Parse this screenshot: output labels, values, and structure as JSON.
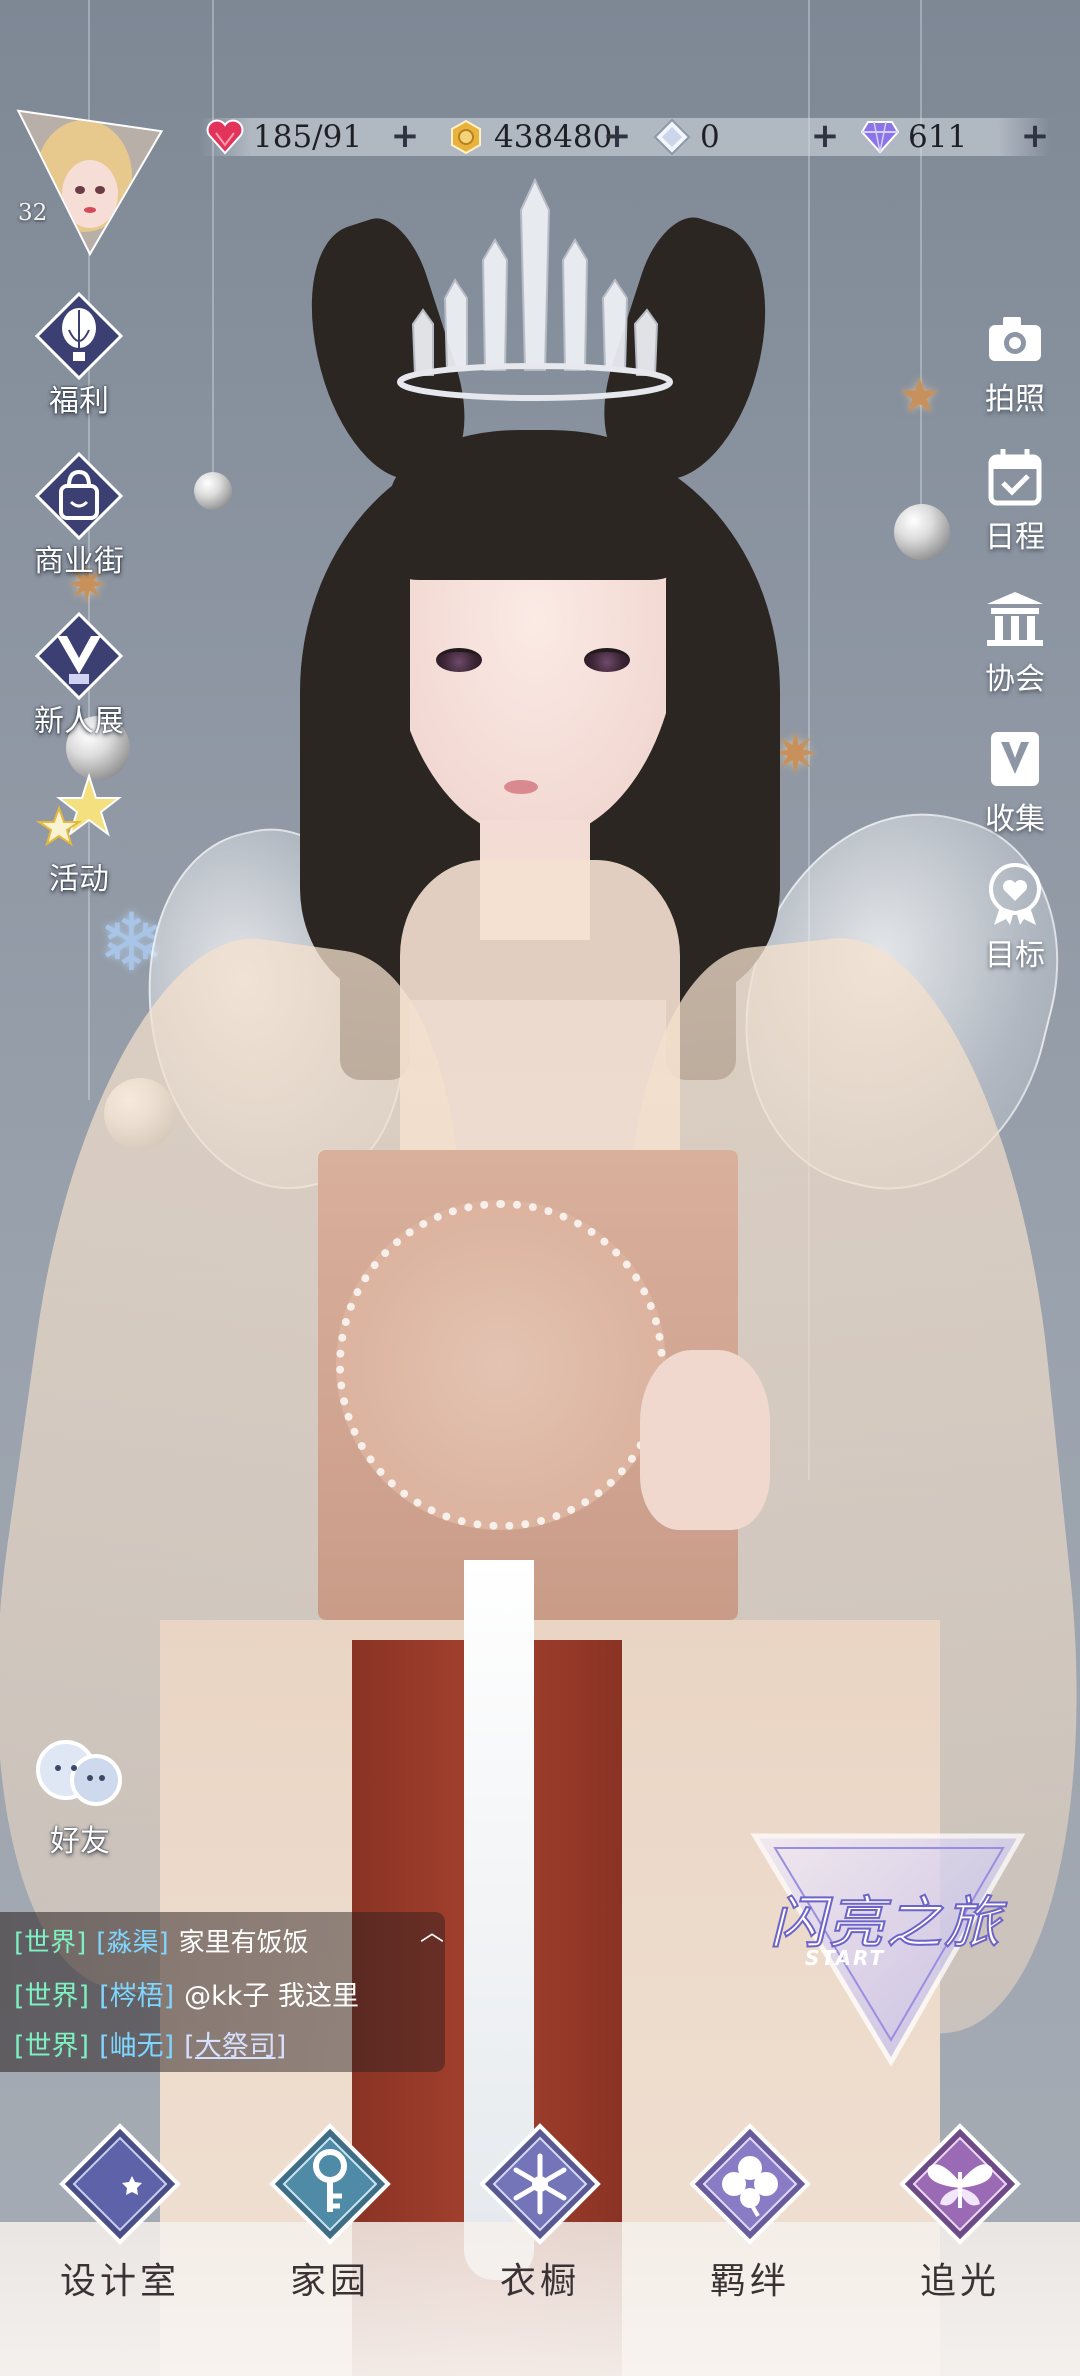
{
  "top_bar": {
    "stamina": {
      "value": "185/91",
      "icon": "heart-gem-icon",
      "color": "#e2345a"
    },
    "coins": {
      "value": "438480",
      "icon": "coin-icon",
      "color": "#e9b23c"
    },
    "crystal": {
      "value": "0",
      "icon": "crystal-icon",
      "color": "#e8eef8"
    },
    "diamonds": {
      "value": "611",
      "icon": "diamond-icon",
      "color": "#8a74e8"
    },
    "plus_label": "+"
  },
  "player": {
    "level": "32"
  },
  "left_menu": [
    {
      "label": "福利",
      "icon": "hot-air-balloon-icon"
    },
    {
      "label": "商业街",
      "icon": "shopping-bag-icon"
    },
    {
      "label": "新人展",
      "icon": "v-badge-icon"
    },
    {
      "label": "活动",
      "icon": "stars-icon"
    }
  ],
  "right_menu": [
    {
      "label": "拍照",
      "icon": "camera-icon"
    },
    {
      "label": "日程",
      "icon": "calendar-check-icon"
    },
    {
      "label": "协会",
      "icon": "building-icon"
    },
    {
      "label": "收集",
      "icon": "v-bookmark-icon"
    },
    {
      "label": "目标",
      "icon": "heart-medal-icon"
    }
  ],
  "friends": {
    "label": "好友",
    "icon": "friends-icon"
  },
  "chat": {
    "toggle_icon": "chevron-up-icon",
    "messages": [
      {
        "channel": "[世界]",
        "user": "[淼渠]",
        "text": "家里有饭饭",
        "link": ""
      },
      {
        "channel": "[世界]",
        "user": "[梣梧]",
        "text": "@kk子 我这里",
        "link": ""
      },
      {
        "channel": "[世界]",
        "user": "[岫无]",
        "text": "",
        "link": "[大祭司]"
      }
    ]
  },
  "start_banner": {
    "title": "闪亮之旅",
    "sub": "START"
  },
  "bottom_nav": [
    {
      "label": "设计室",
      "icon": "crescent-moon-icon"
    },
    {
      "label": "家园",
      "icon": "key-icon"
    },
    {
      "label": "衣橱",
      "icon": "snowflake-icon"
    },
    {
      "label": "羁绊",
      "icon": "clover-icon"
    },
    {
      "label": "追光",
      "icon": "butterfly-icon"
    }
  ]
}
